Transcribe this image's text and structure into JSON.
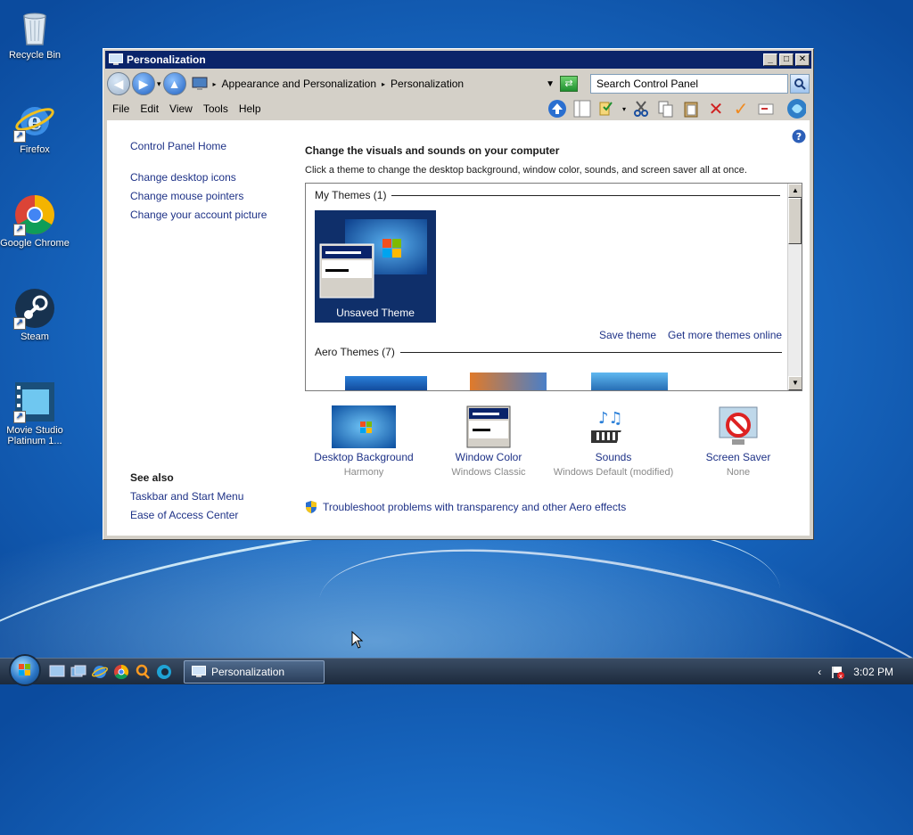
{
  "desktop": {
    "icons": [
      {
        "label": "Recycle Bin"
      },
      {
        "label": "Firefox"
      },
      {
        "label": "Google Chrome"
      },
      {
        "label": "Steam"
      },
      {
        "label": "Movie Studio Platinum 1..."
      }
    ]
  },
  "window": {
    "title": "Personalization",
    "breadcrumb": [
      "Appearance and Personalization",
      "Personalization"
    ],
    "search_placeholder": "Search Control Panel",
    "menu": [
      "File",
      "Edit",
      "View",
      "Tools",
      "Help"
    ]
  },
  "left_pane": {
    "home": "Control Panel Home",
    "links": [
      "Change desktop icons",
      "Change mouse pointers",
      "Change your account picture"
    ],
    "see_also_title": "See also",
    "see_also": [
      "Taskbar and Start Menu",
      "Ease of Access Center"
    ]
  },
  "main": {
    "heading": "Change the visuals and sounds on your computer",
    "description": "Click a theme to change the desktop background, window color, sounds, and screen saver all at once.",
    "my_themes_header": "My Themes (1)",
    "unsaved_theme_label": "Unsaved Theme",
    "save_theme": "Save theme",
    "get_more_themes": "Get more themes online",
    "aero_header": "Aero Themes (7)",
    "bottom_items": [
      {
        "label": "Desktop Background",
        "sub": "Harmony"
      },
      {
        "label": "Window Color",
        "sub": "Windows Classic"
      },
      {
        "label": "Sounds",
        "sub": "Windows Default (modified)"
      },
      {
        "label": "Screen Saver",
        "sub": "None"
      }
    ],
    "troubleshoot": "Troubleshoot problems with transparency and other Aero effects"
  },
  "taskbar": {
    "active_window": "Personalization",
    "time": "3:02 PM"
  },
  "colors": {
    "link": "#1e3287",
    "titlebar": "#0a246a",
    "desktop": "#1a6cc6"
  }
}
